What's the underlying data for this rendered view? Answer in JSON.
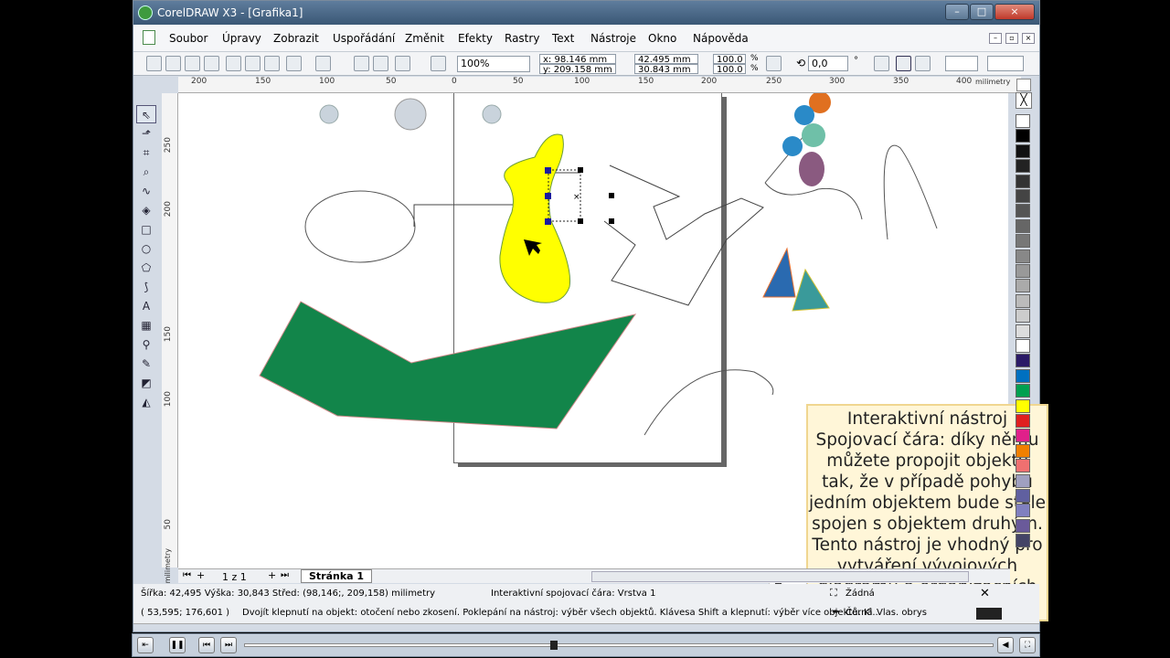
{
  "window": {
    "title": "CorelDRAW X3 - [Grafika1]",
    "minimize": "–",
    "maximize": "□",
    "close": "×"
  },
  "menu": [
    "Soubor",
    "Úpravy",
    "Zobrazit",
    "Uspořádání",
    "Změnit",
    "Efekty",
    "Rastry",
    "Text",
    "Nástroje",
    "Okno",
    "Nápověda"
  ],
  "toolbar": {
    "zoom": "100%",
    "x": "x: 98.146 mm",
    "y": "y: 209.158 mm",
    "w": "42.495 mm",
    "h": "30.843 mm",
    "scale_x": "100.0",
    "scale_y": "100.0",
    "pct": "%",
    "angle": "0,0",
    "deg": "°"
  },
  "ruler": {
    "h_ticks": [
      "200",
      "150",
      "100",
      "50",
      "0",
      "50",
      "100",
      "150",
      "200",
      "250",
      "300",
      "350",
      "400"
    ],
    "h_unit": "milimetry",
    "v_ticks": [
      "250",
      "200",
      "150",
      "100",
      "50"
    ],
    "v_unit": "milimetry"
  },
  "tip": {
    "text": "Interaktivní nástroj Spojovací čára: díky němu můžete propojit objekty tak, že v případě pohybu jedním objektem bude stále spojen s objektem druhým. Tento nástroj je vhodný pro vytváření vývojových diagramů a organizačních schémat."
  },
  "pages": {
    "count": "1 z 1",
    "tab": "Stránka 1"
  },
  "status": {
    "size": "Šířka: 42,495  Výška: 30,843  Střed: (98,146;, 209,158)  milimetry",
    "object": "Interaktivní spojovací čára: Vrstva 1",
    "fill": "Žádná",
    "coords": "( 53,595; 176,601 )",
    "hint": "Dvojít klepnutí na objekt: otočení nebo zkosení. Poklepání na nástroj: výběr všech objektů. Klávesa Shift a klepnutí: výběr více objektů. Kl...",
    "outline_color": "Černá",
    "outline_width": "Vlas. obrys"
  },
  "palette": [
    "#ffffff",
    "#000000",
    "#111111",
    "#222222",
    "#333333",
    "#444444",
    "#555555",
    "#666666",
    "#777777",
    "#888888",
    "#999999",
    "#aaaaaa",
    "#bbbbbb",
    "#cccccc",
    "#dddddd",
    "#ffffff",
    "#2b1a66",
    "#0070c0",
    "#00a050",
    "#ffff00",
    "#e02020",
    "#e0208a",
    "#f08000",
    "#f07070",
    "#a0a0c0",
    "#6060a0",
    "#8080c0",
    "#6a5a9a",
    "#444466"
  ],
  "colors": {
    "yellow_shape": "#ffff00",
    "green_shape": "#12854a"
  }
}
